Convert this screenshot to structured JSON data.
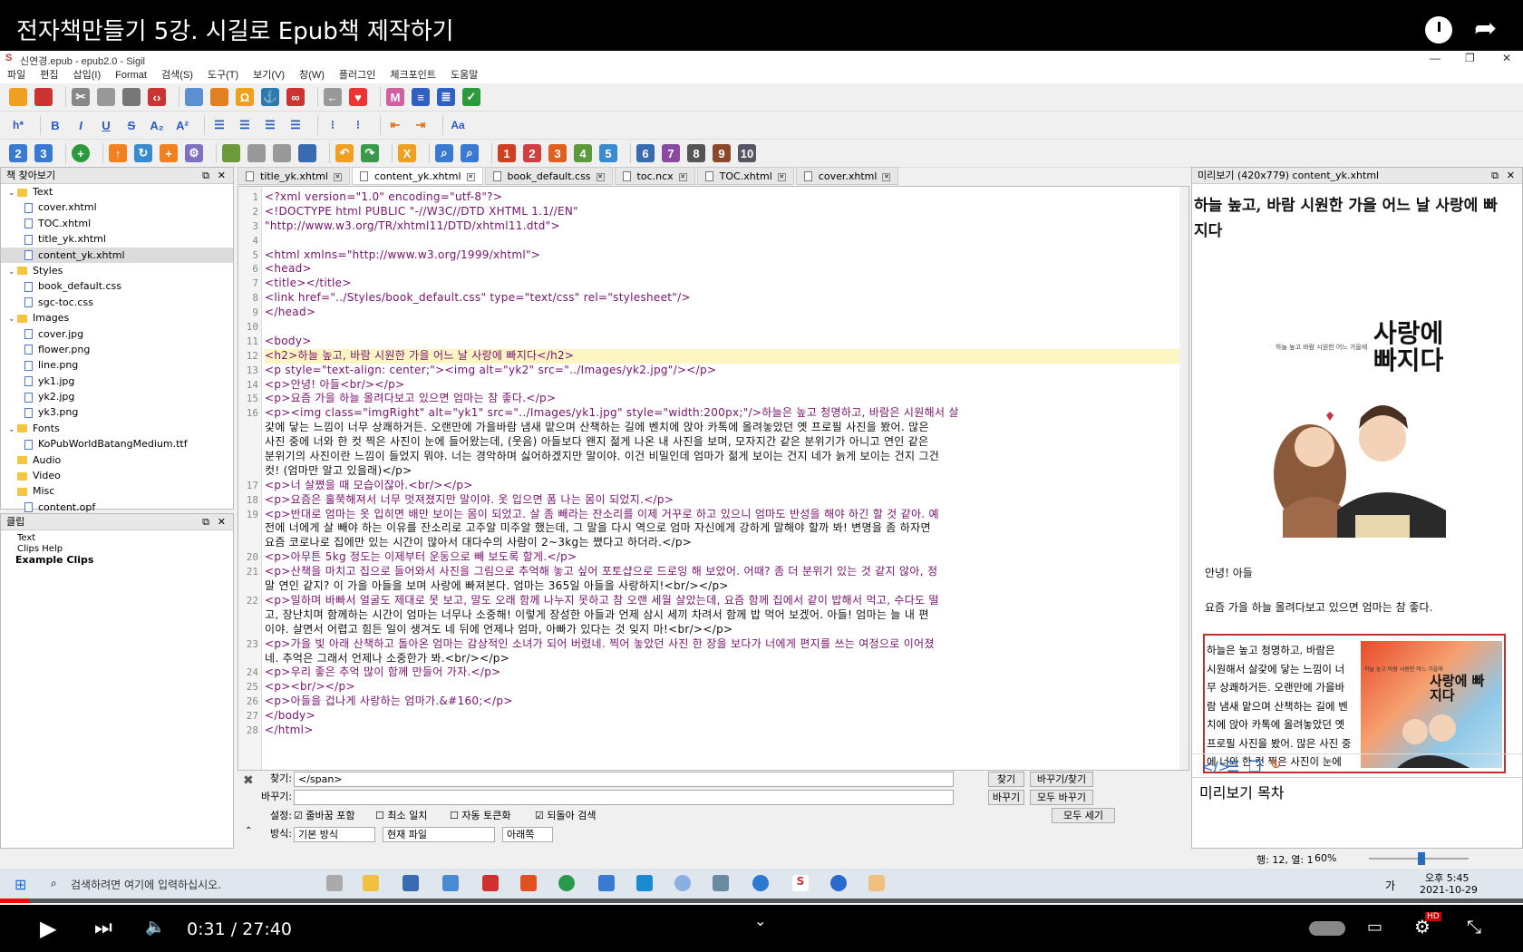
{
  "video": {
    "title": "전자책만들기 5강. 시길로 Epub책 제작하기",
    "time_current": "0:31",
    "time_sep": " / ",
    "time_total": "27:40",
    "progress": 0.019,
    "hd_badge": "HD"
  },
  "window": {
    "title": "신연경.epub - epub2.0 - Sigil",
    "menu": [
      "파일",
      "편집",
      "삽입(I)",
      "Format",
      "검색(S)",
      "도구(T)",
      "보기(V)",
      "창(W)",
      "플러그인",
      "체크포인트",
      "도움말"
    ]
  },
  "format_toolbar": {
    "heading": "h*",
    "bold": "B",
    "italic": "I",
    "underline": "U",
    "strike": "S",
    "sub": "A₂",
    "sup": "A²",
    "case": "Aa"
  },
  "book_browser": {
    "title": "책 찾아보기",
    "items": [
      {
        "label": "Text",
        "kind": "folder",
        "expand": "⌄"
      },
      {
        "label": "cover.xhtml",
        "kind": "file"
      },
      {
        "label": "TOC.xhtml",
        "kind": "file"
      },
      {
        "label": "title_yk.xhtml",
        "kind": "file"
      },
      {
        "label": "content_yk.xhtml",
        "kind": "file",
        "selected": true
      },
      {
        "label": "Styles",
        "kind": "folder",
        "expand": "⌄"
      },
      {
        "label": "book_default.css",
        "kind": "file"
      },
      {
        "label": "sgc-toc.css",
        "kind": "file"
      },
      {
        "label": "Images",
        "kind": "folder",
        "expand": "⌄"
      },
      {
        "label": "cover.jpg",
        "kind": "file"
      },
      {
        "label": "flower.png",
        "kind": "file"
      },
      {
        "label": "line.png",
        "kind": "file"
      },
      {
        "label": "yk1.jpg",
        "kind": "file"
      },
      {
        "label": "yk2.jpg",
        "kind": "file"
      },
      {
        "label": "yk3.png",
        "kind": "file"
      },
      {
        "label": "Fonts",
        "kind": "folder",
        "expand": "⌄"
      },
      {
        "label": "KoPubWorldBatangMedium.ttf",
        "kind": "file"
      },
      {
        "label": "Audio",
        "kind": "folder"
      },
      {
        "label": "Video",
        "kind": "folder"
      },
      {
        "label": "Misc",
        "kind": "folder"
      },
      {
        "label": "content.opf",
        "kind": "file"
      }
    ]
  },
  "clips": {
    "title": "클립",
    "items": [
      "Text",
      "Clips Help",
      "Example Clips"
    ]
  },
  "tabs": [
    "title_yk.xhtml",
    "content_yk.xhtml",
    "book_default.css",
    "toc.ncx",
    "TOC.xhtml",
    "cover.xhtml"
  ],
  "code_lines": [
    "<?xml version=\"1.0\" encoding=\"utf-8\"?>",
    "<!DOCTYPE html PUBLIC \"-//W3C//DTD XHTML 1.1//EN\"",
    "  \"http://www.w3.org/TR/xhtml11/DTD/xhtml11.dtd\">",
    "",
    "<html xmlns=\"http://www.w3.org/1999/xhtml\">",
    "<head>",
    "  <title></title>",
    "  <link href=\"../Styles/book_default.css\" type=\"text/css\" rel=\"stylesheet\"/>",
    "</head>",
    "",
    "<body>",
    "<h2>하늘 높고, 바람 시원한 가을 어느 날 사랑에 빠지다</h2>",
    "<p style=\"text-align: center;\"><img alt=\"yk2\" src=\"../Images/yk2.jpg\"/></p>",
    "<p>안녕! 아들<br/></p>",
    "<p>요즘 가을 하늘 올려다보고 있으면 엄마는 참 좋다.</p>",
    "<p><img class=\"imgRight\" alt=\"yk1\" src=\"../Images/yk1.jpg\" style=\"width:200px;\"/>하늘은 높고 청명하고, 바람은 시원해서 살",
    "갗에 닿는 느낌이 너무 상쾌하거든. 오랜만에 가을바람 냄새 맡으며 산책하는 길에 벤치에 앉아 카톡에 올려놓았던 옛 프로필 사진을 봤어. 많은",
    "사진 중에 너와 한 컷 찍은 사진이 눈에 들어왔는데, (웃음) 아들보다 왠지 젊게 나온 내 사진을 보며, 모자지간 같은 분위기가 아니고 연인 같은",
    "분위기의 사진이란 느낌이 들었지 뭐야. 너는 경악하며 싫어하겠지만 말이야. 이건 비밀인데 엄마가 젊게 보이는 건지 네가 늙게 보이는 건지 그건",
    "컷! (엄마만 알고 있을래)</p>",
    "<p>너 살쪘을 때 모습이잖아.<br/></p>",
    "<p>요즘은 훌쭉해져서 너무 멋져졌지만 말이야. 옷 입으면 폼 나는 몸이 되었지.</p>",
    "<p>반대로 엄마는 옷 입히면 배만 보이는 몸이 되었고. 살 좀 빼라는 잔소리를 이제 거꾸로 하고 있으니 엄마도 반성을 해야 하긴 할 것 같아. 예",
    "전에 너에게 살 빼야 하는 이유를 잔소리로 고주알 미주알 했는데, 그 말을 다시 역으로 엄마 자신에게 강하게 말해야 할까 봐! 변명을 좀 하자면",
    "요즘 코로나로 집에만 있는 시간이 많아서 대다수의 사람이 2~3kg는 쪘다고 하더라.</p>",
    "<p>아무튼 5kg 정도는 이제부터 운동으로 빼 보도록 할게.</p>",
    "<p>산책을 마치고 집으로 들어와서 사진을 그림으로 추억해 놓고 싶어 포토샵으로 드로잉 해 보았어. 어때? 좀 더 분위기 있는 것 같지 않아, 정",
    "말 연인 같지? 이 가을 아들을 보며 사랑에 빠져본다. 엄마는 365일 아들을 사랑하지!<br/></p>",
    "<p>일하며 바빠서 얼굴도 제대로 못 보고, 말도 오래 함께 나누지 못하고 참 오랜 세월 살았는데, 요즘 함께 집에서 같이 밥해서 먹고, 수다도 떨",
    "고, 장난치며 함께하는 시간이 엄마는 너무나 소중해! 이렇게 장성한 아들과 언제 삼시 세끼 차려서 함께 밥 먹어 보겠어. 아들! 엄마는 늘 내 편",
    "이야. 살면서 어렵고 힘든 일이 생겨도 네 뒤에 언제나 엄마, 아빠가 있다는 것 잊지 마!<br/></p>",
    "<p>가을 빛 아래 산책하고 돌아온 엄마는 감상적인 소녀가 되어 버렸네. 찍어 놓았던 사진 한 장을 보다가 너에게 편지를 쓰는 여정으로 이어졌",
    "네. 추억은 그래서 언제나 소중한가 봐.<br/></p>",
    "<p>우리 좋은 추억 많이 함께 만들어 가자.</p>",
    "<p><br/></p>",
    "<p>아들을 겁나게 사랑하는 엄마가.&#160;</p>",
    "</body>",
    "</html>"
  ],
  "line_numbers": [
    "1",
    "2",
    "3",
    "4",
    "5",
    "6",
    "7",
    "8",
    "9",
    "10",
    "11",
    "12",
    "13",
    "14",
    "15",
    "16",
    "",
    "",
    "",
    "",
    "17",
    "18",
    "19",
    "",
    "",
    "20",
    "21",
    "",
    "22",
    "",
    "",
    "23",
    "",
    "24",
    "25",
    "26",
    "27",
    "28"
  ],
  "highlight_line_index": 11,
  "find_replace": {
    "find_label": "찾기:",
    "find_value": "</span>",
    "replace_label": "바꾸기:",
    "replace_value": "",
    "btn_find": "찾기",
    "btn_replace_find": "바꾸기/찾기",
    "btn_replace": "바꾸기",
    "btn_replace_all": "모두 바꾸기",
    "btn_count_all": "모두 세기",
    "settings_label": "설정:",
    "opt1": "줄바꿈 포함",
    "opt2": "최소 일치",
    "opt3": "자동 토큰화",
    "opt4": "되돌아 검색",
    "mode_label": "방식:",
    "mode_value": "기본 방식",
    "scope_value": "현재 파일",
    "direction_value": "아래쪽"
  },
  "preview": {
    "title": "미리보기 (420x779) content_yk.xhtml",
    "heading": "하늘 높고, 바람 시원한 가을 어느 날 사랑에 빠지다",
    "img_caption_small": "하늘 높고 바람 시원한 어느 가을에",
    "img_title": "사랑에 빠지다",
    "p1": "안녕! 아들",
    "p2": "요즘 가을 하늘 올려다보고 있으면 엄마는 참 좋다.",
    "p3_lines": [
      "하늘은 높고 청명하고, 바람은",
      "시원해서 살갗에 닿는 느낌이 너",
      "무 상쾌하거든. 오랜만에 가을바",
      "람 냄새 맡으며 산책하는 길에 벤",
      "치에 앉아 카톡에 올려놓았던 옛",
      "프로필 사진을 봤어. 많은 사진 중",
      "에 너와 한 컷 찍은 사진이 눈에"
    ],
    "tab_preview": "미리보기",
    "tab_toc": "목차"
  },
  "status": {
    "position": "행: 12, 열: 1",
    "zoom": "60%"
  },
  "taskbar": {
    "search_placeholder": "검색하려면 여기에 입력하십시오.",
    "time": "오후 5:45",
    "date": "2021-10-29",
    "ime": "가"
  }
}
